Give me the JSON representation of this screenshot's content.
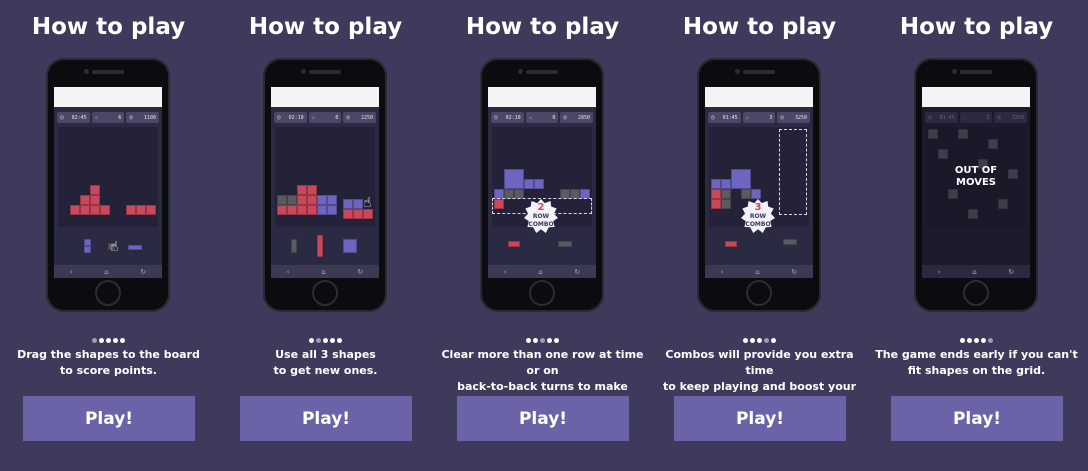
{
  "slides": [
    {
      "title": "How to play",
      "desc_line1": "Drag the shapes to the board",
      "desc_line2": "to score points.",
      "button": "Play!",
      "active_dot": 0,
      "hud": {
        "time": "02:45",
        "stars": "6",
        "score": "1100"
      }
    },
    {
      "title": "How to play",
      "desc_line1": "Use all 3 shapes",
      "desc_line2": "to get new ones.",
      "button": "Play!",
      "active_dot": 1,
      "hud": {
        "time": "02:10",
        "stars": "0",
        "score": "2250"
      }
    },
    {
      "title": "How to play",
      "desc_line1": "Clear more than one row at time or on",
      "desc_line2": "back-to-back turns to make combo.",
      "button": "Play!",
      "active_dot": 2,
      "hud": {
        "time": "02:10",
        "stars": "0",
        "score": "2850"
      },
      "combo": {
        "number": "2",
        "label1": "ROW",
        "label2": "COMBO"
      }
    },
    {
      "title": "How to play",
      "desc_line1": "Combos will provide you extra time",
      "desc_line2": "to keep playing and boost your score.",
      "button": "Play!",
      "active_dot": 3,
      "hud": {
        "time": "01:45",
        "stars": "3",
        "score": "3250"
      },
      "combo": {
        "number": "3",
        "label1": "ROW",
        "label2": "COMBO"
      }
    },
    {
      "title": "How to play",
      "desc_line1": "The game ends early if you can't",
      "desc_line2": "fit shapes on the grid.",
      "button": "Play!",
      "active_dot": 4,
      "hud": {
        "time": "01:45",
        "stars": "3",
        "score": "3250"
      },
      "overlay_line1": "OUT OF",
      "overlay_line2": "MOVES"
    }
  ],
  "icons": {
    "timer": "timer-icon",
    "star": "star-icon",
    "score": "score-icon",
    "hand": "hand-pointer-icon"
  },
  "colors": {
    "background": "#3e3a5c",
    "button": "#6a63a8",
    "red_block": "#c9485b",
    "grey_block": "#5b5a60",
    "blue_block": "#6e65c0"
  }
}
